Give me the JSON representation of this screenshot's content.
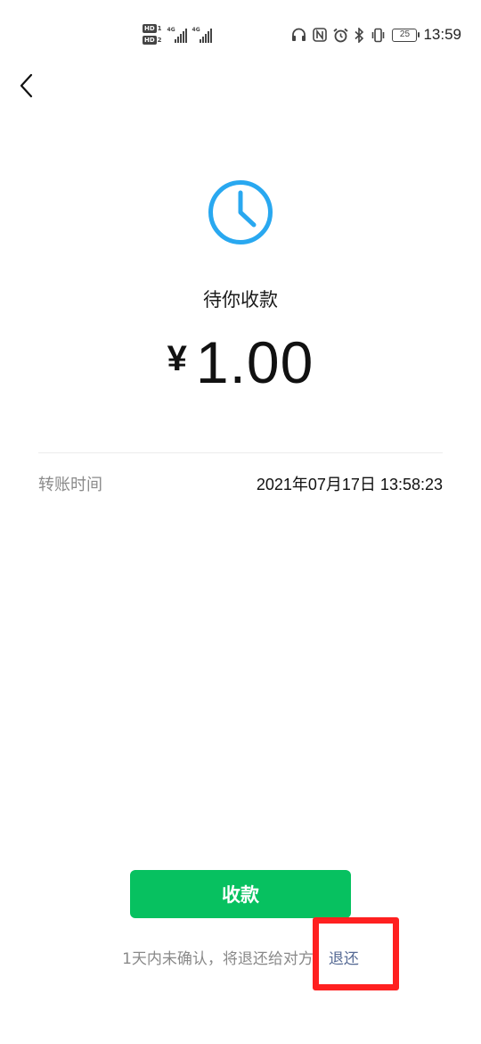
{
  "status_bar": {
    "sim1_label": "HD",
    "sim1_num": "1",
    "sim2_label": "HD",
    "sim2_num": "2",
    "network1": "4G",
    "network2": "4G",
    "battery": "25",
    "time": "13:59",
    "icons": [
      "headphones-icon",
      "nfc-icon",
      "alarm-icon",
      "bluetooth-icon",
      "vibrate-icon",
      "battery-icon"
    ]
  },
  "nav": {
    "back_icon": "chevron-left-icon"
  },
  "transfer": {
    "status_icon": "clock-icon",
    "status_text": "待你收款",
    "currency": "¥",
    "amount": "1.00",
    "time_label": "转账时间",
    "time_value": "2021年07月17日 13:58:23"
  },
  "actions": {
    "receive_label": "收款",
    "notice_text": "1天内未确认，将退还给对方。",
    "return_label": "退还"
  },
  "colors": {
    "accent_green": "#07c160",
    "clock_blue": "#29a8f0",
    "link_blue": "#576b95",
    "highlight_red": "#ff2020"
  }
}
